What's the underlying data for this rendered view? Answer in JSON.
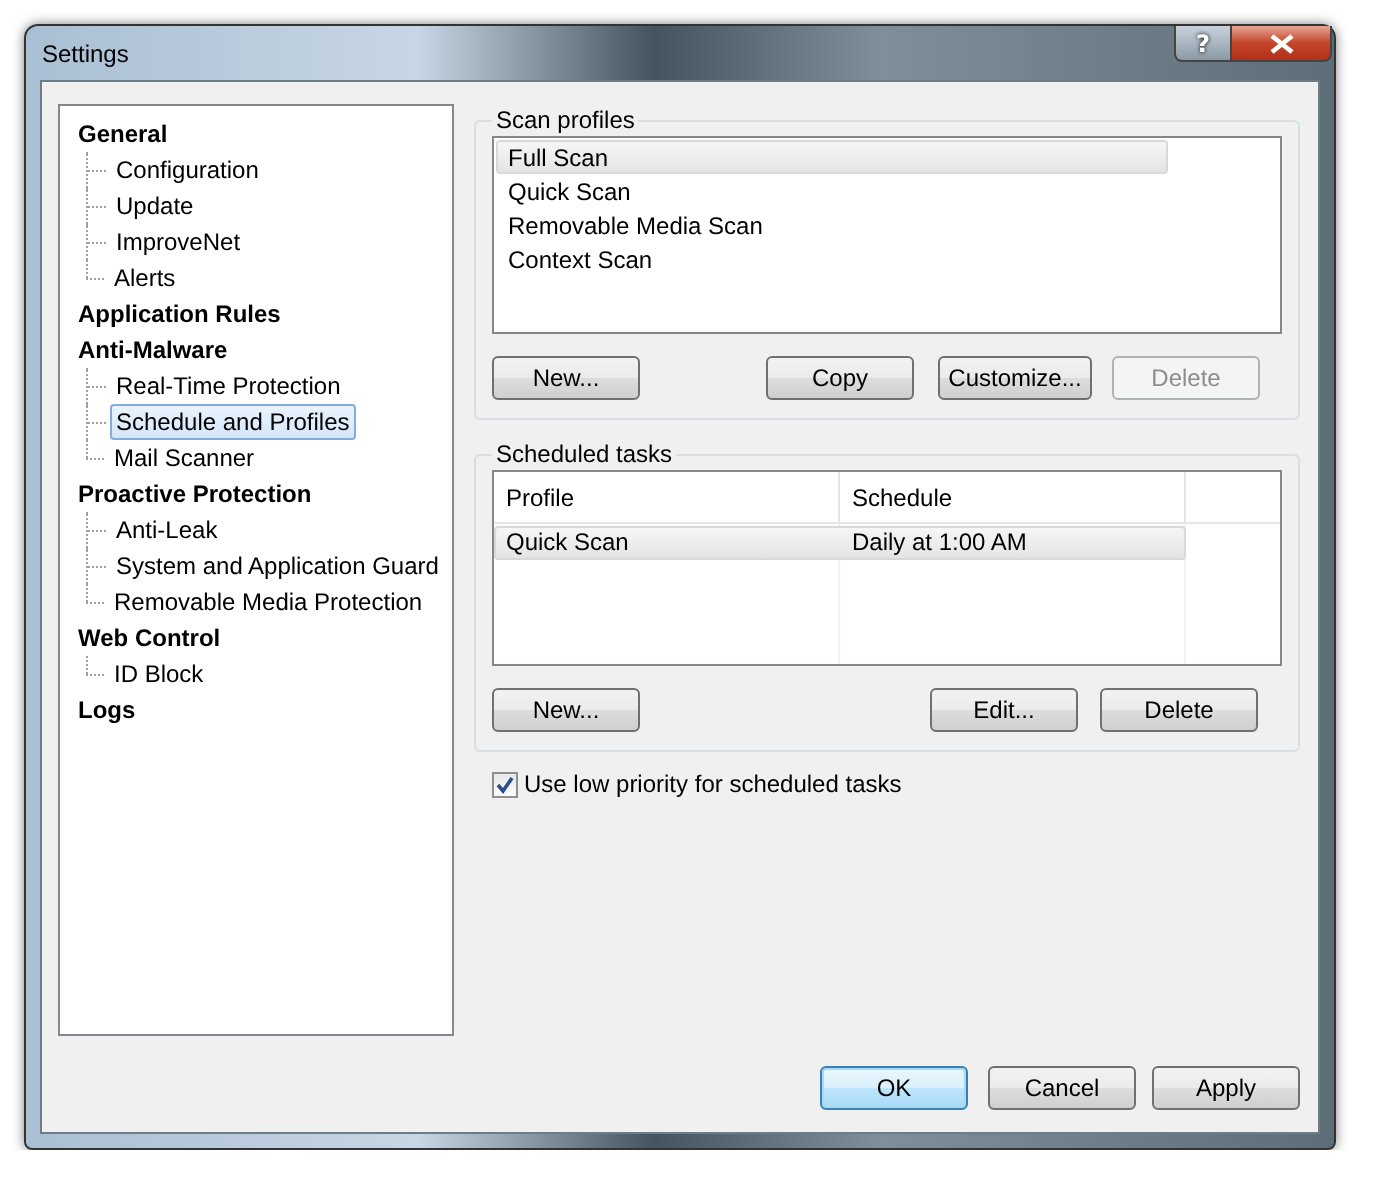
{
  "window": {
    "title": "Settings",
    "help_button": "?"
  },
  "sidebar": {
    "items": [
      {
        "label": "General",
        "selected": false,
        "children": [
          {
            "label": "Configuration",
            "selected": false
          },
          {
            "label": "Update",
            "selected": false
          },
          {
            "label": "ImproveNet",
            "selected": false
          },
          {
            "label": "Alerts",
            "selected": false
          }
        ]
      },
      {
        "label": "Application Rules",
        "selected": false
      },
      {
        "label": "Anti-Malware",
        "selected": false,
        "children": [
          {
            "label": "Real-Time Protection",
            "selected": false
          },
          {
            "label": "Schedule and Profiles",
            "selected": true
          },
          {
            "label": "Mail Scanner",
            "selected": false
          }
        ]
      },
      {
        "label": "Proactive Protection",
        "selected": false,
        "children": [
          {
            "label": "Anti-Leak",
            "selected": false
          },
          {
            "label": "System and Application Guard",
            "selected": false
          },
          {
            "label": "Removable Media Protection",
            "selected": false
          }
        ]
      },
      {
        "label": "Web Control",
        "selected": false,
        "children": [
          {
            "label": "ID Block",
            "selected": false
          }
        ]
      },
      {
        "label": "Logs",
        "selected": false
      }
    ]
  },
  "scan_profiles": {
    "title": "Scan profiles",
    "items": [
      {
        "label": "Full Scan",
        "selected": true
      },
      {
        "label": "Quick Scan",
        "selected": false
      },
      {
        "label": "Removable Media Scan",
        "selected": false
      },
      {
        "label": "Context Scan",
        "selected": false
      }
    ],
    "buttons": [
      {
        "label": "New...",
        "disabled": false
      },
      {
        "label": "Copy",
        "disabled": false
      },
      {
        "label": "Customize...",
        "disabled": false
      },
      {
        "label": "Delete",
        "disabled": true
      }
    ]
  },
  "scheduled_tasks": {
    "title": "Scheduled tasks",
    "columns": [
      "Profile",
      "Schedule"
    ],
    "rows": [
      {
        "cells": [
          "Quick Scan",
          "Daily at 1:00 AM"
        ],
        "selected": true
      }
    ],
    "buttons": [
      {
        "label": "New...",
        "disabled": false
      },
      {
        "label": "Edit...",
        "disabled": false
      },
      {
        "label": "Delete",
        "disabled": false
      }
    ]
  },
  "low_priority": {
    "label": "Use low priority for scheduled tasks",
    "checked": true
  },
  "dialog_buttons": [
    {
      "label": "OK",
      "default": true
    },
    {
      "label": "Cancel",
      "default": false
    },
    {
      "label": "Apply",
      "default": false
    }
  ]
}
